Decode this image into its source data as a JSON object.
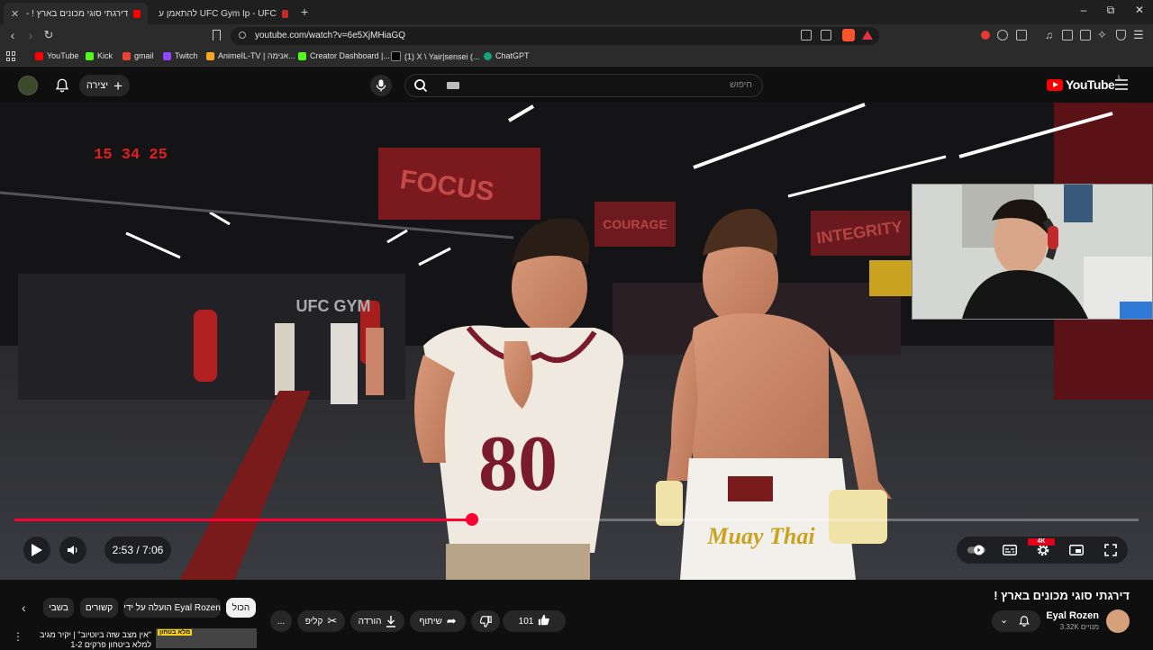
{
  "browser": {
    "tabs": [
      {
        "title": "דירגתי סוגי מכונים בארץ ! - ...e",
        "active": true
      },
      {
        "title": "UFC Gym Ip - UFC להתאמן על הקצה",
        "active": false
      }
    ],
    "new_tab": "+",
    "window_controls": {
      "minimize": "–",
      "restore": "⧉",
      "close": "✕"
    },
    "url": "youtube.com/watch?v=6e5XjMHiaGQ",
    "bookmarks": [
      {
        "label": "YouTube",
        "color": "#ff0000"
      },
      {
        "label": "Kick",
        "color": "#53fc18"
      },
      {
        "label": "gmail",
        "color": "#ea4335"
      },
      {
        "label": "Twitch",
        "color": "#9146ff"
      },
      {
        "label": "AnimeIL-TV | אנימה...",
        "color": "#f5a623"
      },
      {
        "label": "Creator Dashboard |...",
        "color": "#53fc18"
      },
      {
        "label": "(1) X \\ Yair|sensei (...",
        "color": "#000000"
      },
      {
        "label": "ChatGPT",
        "color": "#10a37f"
      }
    ]
  },
  "yt_header": {
    "create_label": "יצירה",
    "search_placeholder": "חיפוש",
    "logo_text": "YouTube",
    "logo_sup": "IL"
  },
  "player": {
    "time": "2:53 / 7:06",
    "progress": 0.407,
    "quality_badge": "4K",
    "clock_overlay": "15 34 25",
    "gym_signs": [
      "FOCUS",
      "COURAGE",
      "INTEGRITY",
      "UFC GYM"
    ],
    "jersey_number": "80",
    "shorts_text": "Muay Thai"
  },
  "video": {
    "title": "דירגתי סוגי מכונים בארץ !",
    "channel_name": "Eyal Rozen",
    "subscribers": "3.32K מנויים",
    "likes": "101",
    "share_label": "שיתוף",
    "download_label": "הורדה",
    "clip_label": "קליפ",
    "more": "..."
  },
  "chips": [
    "הכול",
    "הועלה על ידי Eyal Rozen",
    "קשורים",
    "בשבי"
  ],
  "recommendation": {
    "title": "\"אין מצב שזה ביוטיוב\" | יקיר מגיב למלא ביטחון פרקים 1-2",
    "thumb_text": "מלא בטחון"
  },
  "colors": {
    "accent": "#ff0033",
    "bg": "#0f0f0f",
    "chip": "#272727"
  }
}
